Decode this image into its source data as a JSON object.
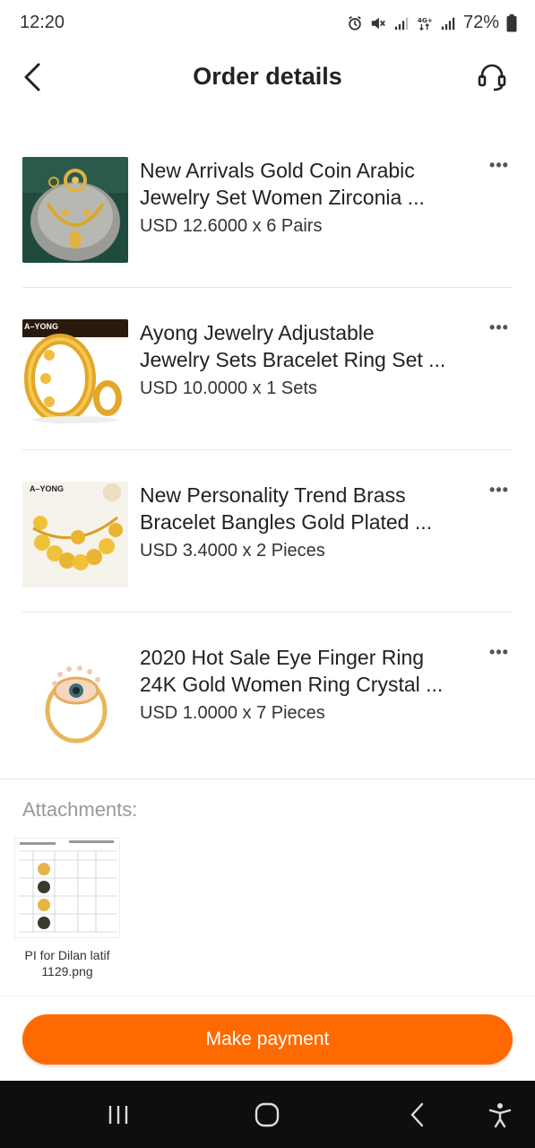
{
  "status_bar": {
    "time": "12:20",
    "battery": "72%",
    "icons": [
      "alarm-icon",
      "mute-icon",
      "signal-icon",
      "network-4g-icon",
      "signal-icon",
      "battery-icon"
    ]
  },
  "header": {
    "title": "Order details",
    "back_icon": "chevron-left-icon",
    "support_icon": "headset-icon"
  },
  "products": [
    {
      "title_line1": "New Arrivals Gold Coin Arabic",
      "title_line2": "Jewelry Set Women Zirconia ...",
      "price": "USD 12.6000 x 6 Pairs",
      "thumb": "necklace-set-image"
    },
    {
      "title_line1": "Ayong Jewelry Adjustable",
      "title_line2": "Jewelry Sets Bracelet Ring Set ...",
      "price": "USD 10.0000 x 1 Sets",
      "thumb": "bracelet-ring-image",
      "thumb_label": "A–YONG"
    },
    {
      "title_line1": "New Personality Trend Brass",
      "title_line2": "Bracelet Bangles Gold Plated ...",
      "price": "USD 3.4000 x 2 Pieces",
      "thumb": "coin-bracelet-image",
      "thumb_label": "A–YONG"
    },
    {
      "title_line1": "2020 Hot Sale Eye Finger Ring",
      "title_line2": "24K Gold Women Ring Crystal ...",
      "price": "USD 1.0000 x 7 Pieces",
      "thumb": "eye-ring-image"
    }
  ],
  "attachments": {
    "label": "Attachments:",
    "files": [
      {
        "name_line1": "PI for Dilan latif",
        "name_line2": "1129.png"
      }
    ]
  },
  "pay_button": {
    "label": "Make payment"
  },
  "colors": {
    "accent": "#ff6a00",
    "navbar": "#0e0e0e"
  },
  "nav_bar": {
    "icons": [
      "recent-apps-icon",
      "home-icon",
      "back-icon",
      "accessibility-icon"
    ]
  }
}
